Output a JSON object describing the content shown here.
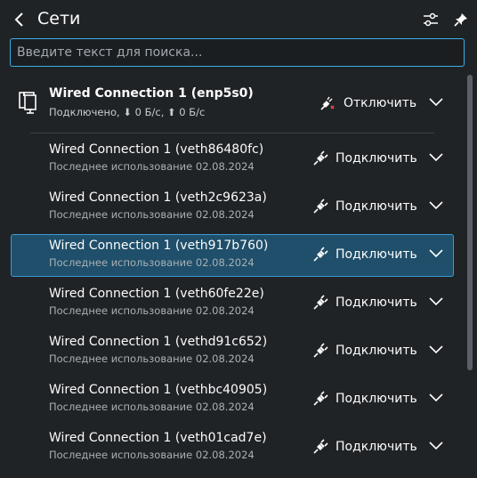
{
  "header": {
    "title": "Сети",
    "back_icon": "chevron-left-icon",
    "settings_icon": "sliders-icon",
    "pin_icon": "pin-icon"
  },
  "search": {
    "placeholder": "Введите текст для поиска...",
    "value": ""
  },
  "active_connection": {
    "title": "Wired Connection 1 (enp5s0)",
    "status": "Подключено, ⬇ 0 Б/с, ⬆ 0 Б/с",
    "action_label": "Отключить",
    "icon": "desktop-computer-icon"
  },
  "connections": [
    {
      "title": "Wired Connection 1 (veth86480fc)",
      "subtitle": "Последнее использование 02.08.2024",
      "action_label": "Подключить",
      "selected": false
    },
    {
      "title": "Wired Connection 1 (veth2c9623a)",
      "subtitle": "Последнее использование 02.08.2024",
      "action_label": "Подключить",
      "selected": false
    },
    {
      "title": "Wired Connection 1 (veth917b760)",
      "subtitle": "Последнее использование 02.08.2024",
      "action_label": "Подключить",
      "selected": true
    },
    {
      "title": "Wired Connection 1 (veth60fe22e)",
      "subtitle": "Последнее использование 02.08.2024",
      "action_label": "Подключить",
      "selected": false
    },
    {
      "title": "Wired Connection 1 (vethd91c652)",
      "subtitle": "Последнее использование 02.08.2024",
      "action_label": "Подключить",
      "selected": false
    },
    {
      "title": "Wired Connection 1 (vethbc40905)",
      "subtitle": "Последнее использование 02.08.2024",
      "action_label": "Подключить",
      "selected": false
    },
    {
      "title": "Wired Connection 1 (veth01cad7e)",
      "subtitle": "Последнее использование 02.08.2024",
      "action_label": "Подключить",
      "selected": false
    }
  ],
  "colors": {
    "background": "#202326",
    "accent": "#3daee9",
    "selected_row": "#1f4f6a",
    "disconnect_mark": "#da4453"
  }
}
